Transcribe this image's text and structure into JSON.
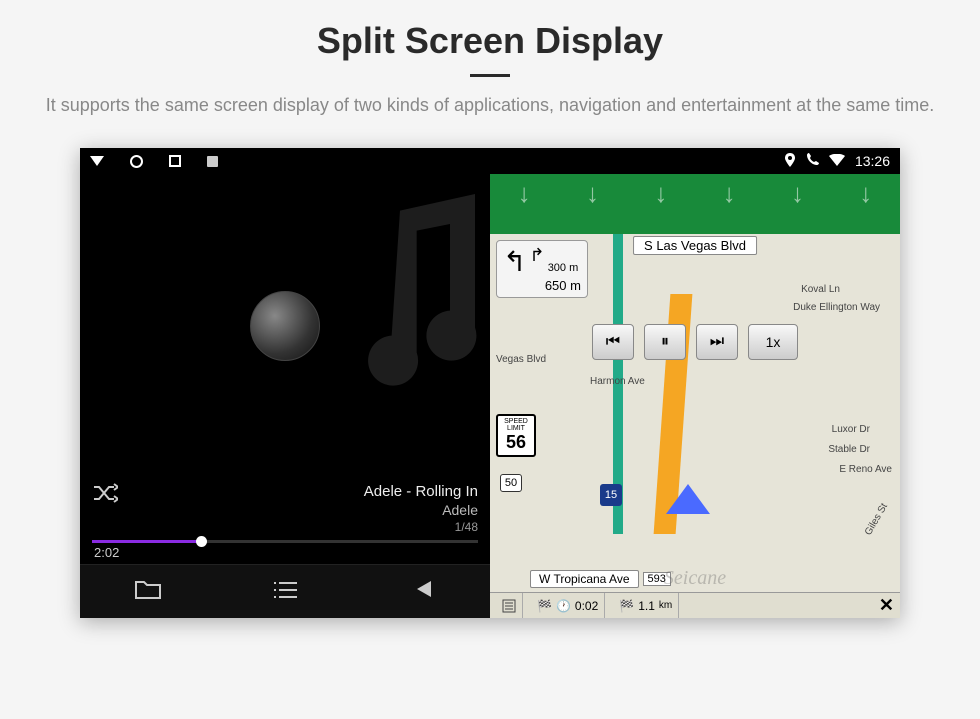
{
  "header": {
    "title": "Split Screen Display",
    "subtitle": "It supports the same screen display of two kinds of applications, navigation and entertainment at the same time."
  },
  "statusbar": {
    "time": "13:26",
    "icons": {
      "location": "location-icon",
      "phone": "phone-icon",
      "wifi": "wifi-icon"
    }
  },
  "music": {
    "song": "Adele - Rolling In",
    "artist": "Adele",
    "counter": "1/48",
    "elapsed": "2:02",
    "shuffle_icon": "shuffle-icon",
    "bottom": {
      "folder": "folder-icon",
      "list": "list-icon",
      "prev": "prev-icon"
    }
  },
  "map": {
    "street_top": "S Las Vegas Blvd",
    "street_bottom": "W Tropicana Ave",
    "street_bottom_num": "593",
    "turn": {
      "next_dist": "300",
      "next_unit": "m",
      "main_dist": "650",
      "main_unit": "m"
    },
    "speed": {
      "label1": "SPEED",
      "label2": "LIMIT",
      "value": "56"
    },
    "controls": {
      "prev": "⏮",
      "pause": "⏸",
      "next": "⏭",
      "rate": "1x"
    },
    "bottom": {
      "time": "0:02",
      "dist": "1.1",
      "dist_unit": "km",
      "close": "✕"
    },
    "labels": {
      "koval": "Koval Ln",
      "duke": "Duke Ellington Way",
      "luxor": "Luxor Dr",
      "reno": "E Reno Ave",
      "vegas": "Vegas Blvd",
      "harmon": "Harmon Ave",
      "stable": "Stable Dr",
      "giles": "Giles St"
    },
    "shields": {
      "i15": "15",
      "rt50": "50"
    }
  },
  "watermark": "Seicane"
}
